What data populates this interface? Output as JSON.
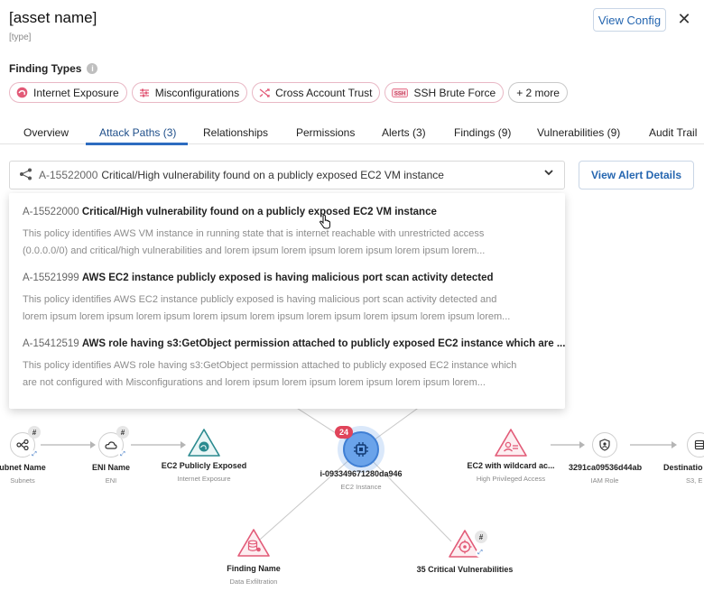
{
  "asset": {
    "name": "[asset name]",
    "type": "[type]"
  },
  "header": {
    "view_config_label": "View Config",
    "close_label": "✕"
  },
  "finding_types": {
    "label": "Finding Types",
    "info_icon": "i",
    "chips": [
      {
        "label": "Internet Exposure",
        "icon": "globe-icon"
      },
      {
        "label": "Misconfigurations",
        "icon": "sliders-icon"
      },
      {
        "label": "Cross Account Trust",
        "icon": "shuffle-icon"
      },
      {
        "label": "SSH Brute Force",
        "icon": "ssh-icon"
      }
    ],
    "more_label": "+ 2 more"
  },
  "tabs": [
    {
      "label": "Overview"
    },
    {
      "label": "Attack Paths (3)",
      "active": true
    },
    {
      "label": "Relationships"
    },
    {
      "label": "Permissions"
    },
    {
      "label": "Alerts (3)"
    },
    {
      "label": "Findings (9)"
    },
    {
      "label": "Vulnerabilities (9)"
    },
    {
      "label": "Audit Trail"
    }
  ],
  "alert_select": {
    "selected_id": "A-15522000",
    "selected_title": "Critical/High vulnerability found on a publicly exposed EC2 VM instance",
    "view_details_label": "View Alert Details",
    "options": [
      {
        "id": "A-15522000",
        "title": "Critical/High vulnerability found on a publicly exposed EC2 VM instance",
        "desc_line1": "This policy identifies AWS VM instance in running state that is internet reachable with unrestricted access",
        "desc_line2": "(0.0.0.0/0) and critical/high vulnerabilities and lorem ipsum lorem ipsum lorem ipsum lorem ipsum lorem..."
      },
      {
        "id": "A-15521999",
        "title": "AWS EC2 instance publicly exposed is having malicious port scan activity detected",
        "desc_line1": "This policy identifies AWS EC2 instance publicly exposed is having malicious port scan activity detected and",
        "desc_line2": "lorem ipsum lorem ipsum lorem ipsum lorem ipsum lorem ipsum lorem ipsum lorem ipsum lorem ipsum lorem..."
      },
      {
        "id": "A-15412519",
        "title": "AWS role having s3:GetObject permission attached to publicly exposed EC2 instance which are ...",
        "desc_line1": "This policy identifies AWS role having s3:GetObject permission attached to publicly exposed EC2 instance which",
        "desc_line2": "are not configured with Misconfigurations and lorem ipsum lorem ipsum lorem ipsum lorem ipsum lorem..."
      }
    ]
  },
  "graph": {
    "center": {
      "label": "i-093349671280da946",
      "sub": "EC2 Instance",
      "badge": "24"
    },
    "nodes": {
      "subnet": {
        "label": "ubnet Name",
        "sub": "Subnets",
        "hash": "#"
      },
      "eni": {
        "label": "ENI Name",
        "sub": "ENI",
        "hash": "#"
      },
      "ec2_exposed": {
        "label": "EC2 Publicly Exposed",
        "sub": "Internet Exposure"
      },
      "ec2_wildcard": {
        "label": "EC2 with wildcard ac...",
        "sub": "High Privileged Access"
      },
      "iam_role": {
        "label": "3291ca09536d44ab",
        "sub": "IAM Role"
      },
      "destination": {
        "label": "Destinatio",
        "sub": "S3, E"
      },
      "finding": {
        "label": "Finding Name",
        "sub": "Data Exfiltration"
      },
      "vulns": {
        "label": "35 Critical Vulnerabilities",
        "hash": "#"
      }
    }
  },
  "colors": {
    "accent": "#2d6cc0",
    "alert": "#d9415f",
    "badge": "#e0445a",
    "internet_exposure": "#2a8a8f"
  }
}
